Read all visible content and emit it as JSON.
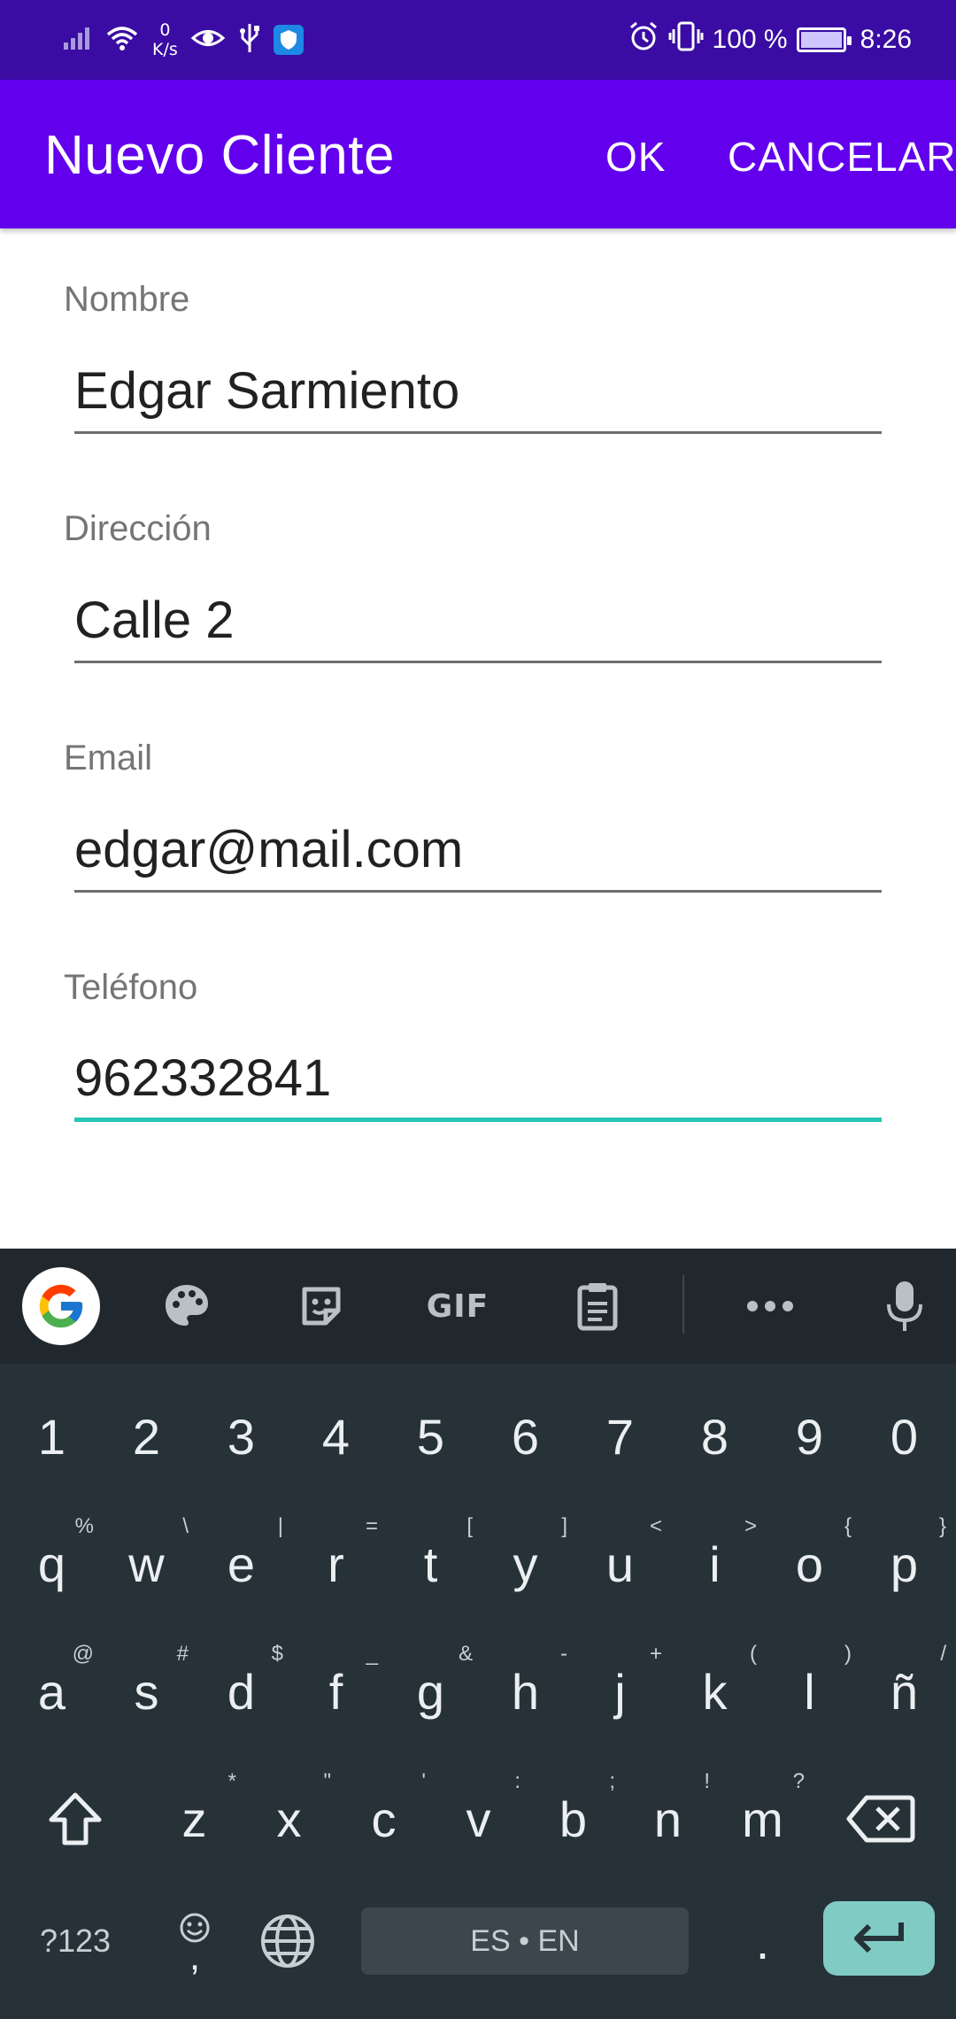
{
  "status_bar": {
    "net_speed_value": "0",
    "net_speed_unit": "K/s",
    "battery_percent": "100 %",
    "time": "8:26",
    "icons": [
      "signal-icon",
      "wifi-icon",
      "eye-icon",
      "usb-icon",
      "shield-icon",
      "alarm-icon",
      "vibrate-icon",
      "battery-icon"
    ]
  },
  "app_bar": {
    "title": "Nuevo Cliente",
    "ok_label": "OK",
    "cancel_label": "CANCELAR"
  },
  "form": {
    "fields": [
      {
        "label": "Nombre",
        "value": "Edgar Sarmiento"
      },
      {
        "label": "Dirección",
        "value": "Calle 2"
      },
      {
        "label": "Email",
        "value": "edgar@mail.com"
      },
      {
        "label": "Teléfono",
        "value": "962332841"
      }
    ],
    "focused_field": 3,
    "accent_color": "#26c6b5"
  },
  "colors": {
    "status_bar": "#3a0ca3",
    "app_bar": "#6200ee",
    "keyboard_bg": "#263238",
    "enter_key": "#80cbc4"
  },
  "keyboard": {
    "toolbar_icons": [
      "google-icon",
      "palette-icon",
      "sticker-icon",
      "gif-icon",
      "clipboard-icon",
      "more-icon",
      "microphone-icon"
    ],
    "gif_label": "GIF",
    "number_row": [
      "1",
      "2",
      "3",
      "4",
      "5",
      "6",
      "7",
      "8",
      "9",
      "0"
    ],
    "row1": [
      "q",
      "w",
      "e",
      "r",
      "t",
      "y",
      "u",
      "i",
      "o",
      "p"
    ],
    "row1_hints": [
      "%",
      "\\",
      "|",
      "=",
      "[",
      "]",
      "<",
      ">",
      "{",
      "}"
    ],
    "row2": [
      "a",
      "s",
      "d",
      "f",
      "g",
      "h",
      "j",
      "k",
      "l",
      "ñ"
    ],
    "row2_hints": [
      "@",
      "#",
      "$",
      "_",
      "&",
      "-",
      "+",
      "(",
      ")",
      "/"
    ],
    "row3": [
      "z",
      "x",
      "c",
      "v",
      "b",
      "n",
      "m"
    ],
    "row3_hints": [
      "*",
      "\"",
      "'",
      ":",
      ";",
      "!",
      "?"
    ],
    "symbols_label": "?123",
    "emoji_comma": ",",
    "space_label": "ES • EN",
    "period_label": "."
  }
}
